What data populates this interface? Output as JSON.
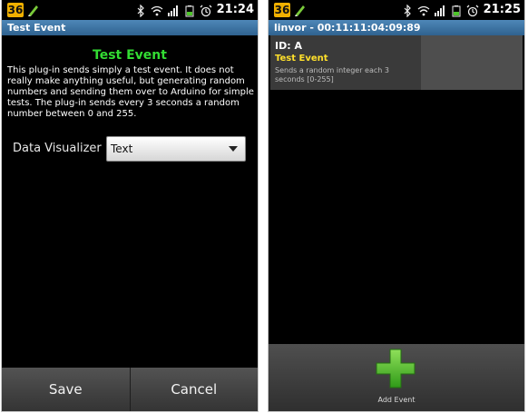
{
  "left_screen": {
    "status_bar": {
      "badge": "36",
      "time": "21:24",
      "icons": [
        "edit-pen-icon",
        "bluetooth-icon",
        "wifi-icon",
        "signal-icon",
        "battery-icon",
        "alarm-icon"
      ]
    },
    "title": "Test Event",
    "heading": "Test Event",
    "description": "This plug-in sends simply a test event. It does not really make anything useful, but generating random numbers and sending them over to Arduino for simple tests. The plug-in sends every 3 seconds a random number between 0 and 255.",
    "data_visualizer": {
      "label": "Data Visualizer",
      "selected": "Text"
    },
    "buttons": {
      "save": "Save",
      "cancel": "Cancel"
    }
  },
  "right_screen": {
    "status_bar": {
      "badge": "36",
      "time": "21:25",
      "icons": [
        "edit-pen-icon",
        "bluetooth-icon",
        "wifi-icon",
        "signal-icon",
        "battery-icon",
        "alarm-icon"
      ]
    },
    "title": "linvor - 00:11:11:04:09:89",
    "event": {
      "id": "ID: A",
      "name": "Test Event",
      "summary": "Sends a random integer each 3 seconds [0-255]"
    },
    "add_event_label": "Add Event"
  },
  "colors": {
    "title_bar": "#3f74a3",
    "heading_green": "#33dd33",
    "event_name_yellow": "#ffe02b",
    "add_icon_green": "#4ec42a"
  }
}
